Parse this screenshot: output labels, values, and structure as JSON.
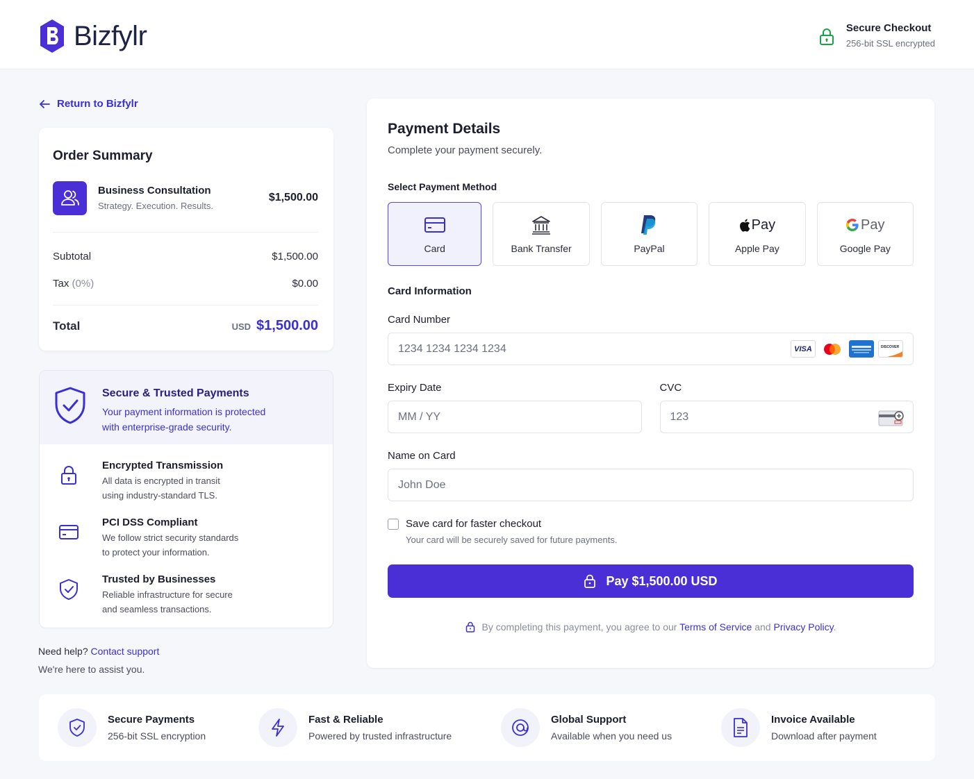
{
  "header": {
    "logo_text": "Bizfylr",
    "secure_title": "Secure Checkout",
    "secure_sub": "256-bit SSL encrypted"
  },
  "nav": {
    "return_label": "Return to Bizfylr"
  },
  "order": {
    "title": "Order Summary",
    "item_name": "Business Consultation",
    "item_desc": "Strategy. Execution. Results.",
    "item_price": "$1,500.00",
    "subtotal_label": "Subtotal",
    "subtotal_value": "$1,500.00",
    "tax_label": "Tax",
    "tax_rate": "(0%)",
    "tax_value": "$0.00",
    "total_label": "Total",
    "total_currency": "USD",
    "total_value": "$1,500.00"
  },
  "trust": {
    "title": "Secure & Trusted Payments",
    "sub_line1": "Your payment information is protected",
    "sub_line2": "with enterprise-grade security.",
    "features": [
      {
        "title": "Encrypted Transmission",
        "line1": "All data is encrypted in transit",
        "line2": "using industry-standard TLS."
      },
      {
        "title": "PCI DSS Compliant",
        "line1": "We follow strict security standards",
        "line2": "to protect your information."
      },
      {
        "title": "Trusted by Businesses",
        "line1": "Reliable infrastructure for secure",
        "line2": "and seamless transactions."
      }
    ]
  },
  "help": {
    "prefix": "Need help?",
    "link": "Contact support",
    "sub": "We're here to assist you."
  },
  "payment": {
    "title": "Payment Details",
    "subtitle": "Complete your payment securely.",
    "method_label": "Select Payment Method",
    "methods": [
      {
        "label": "Card",
        "active": true
      },
      {
        "label": "Bank Transfer",
        "active": false
      },
      {
        "label": "PayPal",
        "active": false
      },
      {
        "label": "Apple Pay",
        "active": false,
        "mark": "Pay"
      },
      {
        "label": "Google Pay",
        "active": false,
        "mark": "Pay"
      }
    ],
    "card_info_label": "Card Information",
    "card_number_label": "Card Number",
    "card_number_placeholder": "1234 1234 1234 1234",
    "brands": [
      "VISA",
      "Mastercard",
      "American Express",
      "DISCOVER"
    ],
    "expiry_label": "Expiry Date",
    "expiry_placeholder": "MM / YY",
    "cvc_label": "CVC",
    "cvc_placeholder": "123",
    "name_label": "Name on Card",
    "name_placeholder": "John Doe",
    "save_label": "Save card for faster checkout",
    "save_sub": "Your card will be securely saved for future payments.",
    "pay_button": "Pay $1,500.00 USD",
    "legal_prefix": "By completing this payment, you agree to our",
    "legal_terms": "Terms of Service",
    "legal_and": "and",
    "legal_privacy": "Privacy Policy",
    "legal_end": "."
  },
  "footer": {
    "items": [
      {
        "title": "Secure Payments",
        "sub": "256-bit SSL encryption",
        "icon": "shield-check-icon"
      },
      {
        "title": "Fast & Reliable",
        "sub": "Powered by trusted infrastructure",
        "icon": "lightning-icon"
      },
      {
        "title": "Global Support",
        "sub": "Available when you need us",
        "icon": "support-icon"
      },
      {
        "title": "Invoice Available",
        "sub": "Download after payment",
        "icon": "document-icon"
      }
    ]
  },
  "colors": {
    "accent": "#4a2ed6",
    "link": "#3a2fd4",
    "success": "#16a34a"
  }
}
